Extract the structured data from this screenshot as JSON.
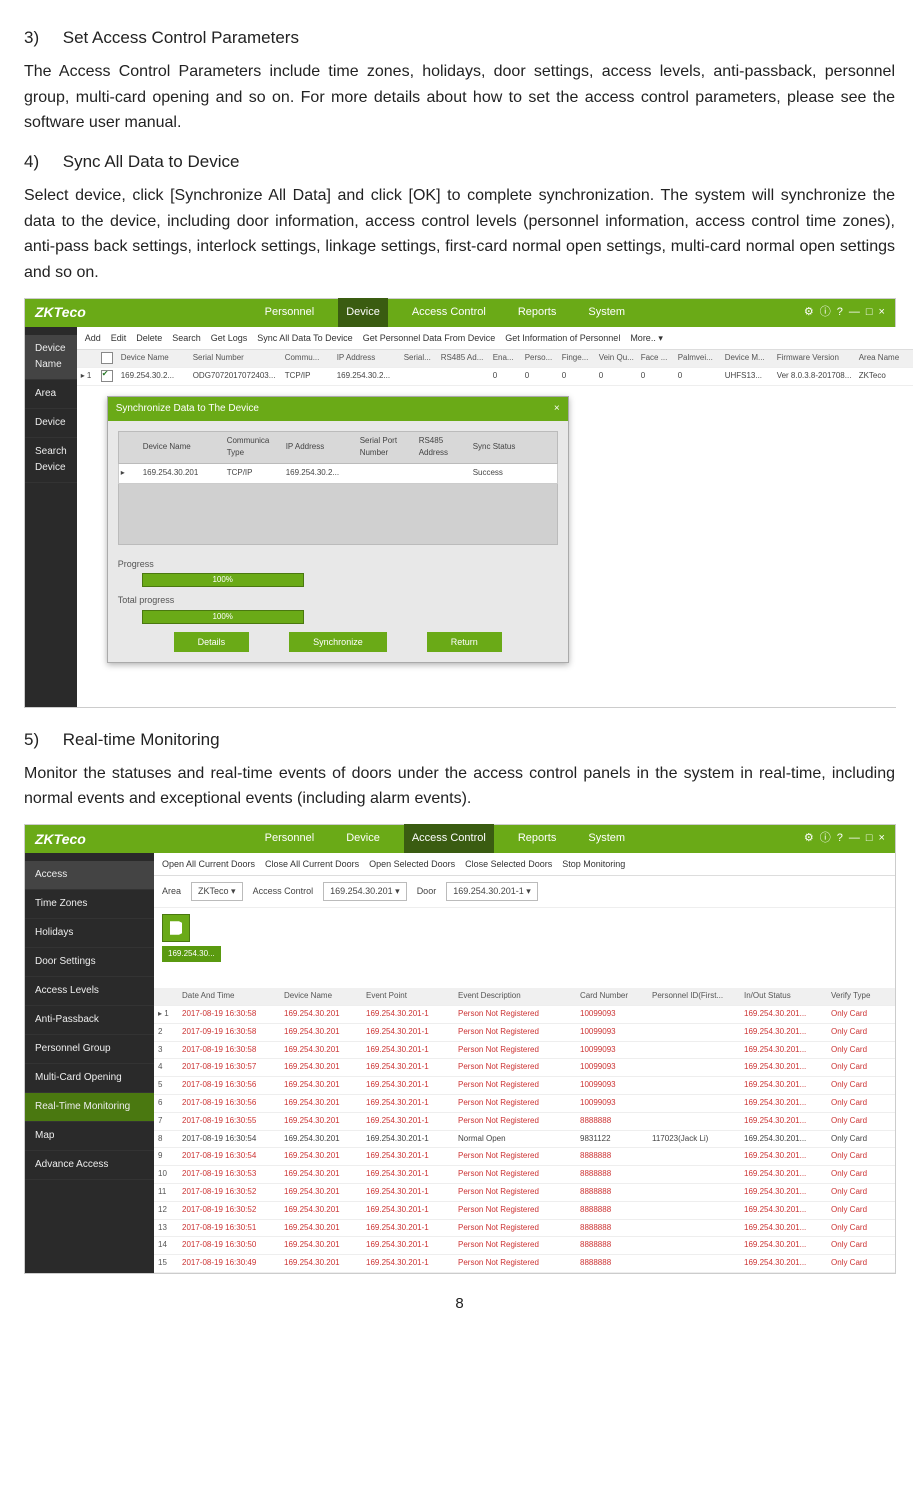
{
  "s3": {
    "num": "3)",
    "title": "Set Access Control Parameters",
    "para": "The Access Control Parameters include time zones, holidays, door settings, access levels, anti-passback, personnel group, multi-card opening and so on. For more details about how to set the access control parameters, please see the software user manual."
  },
  "s4": {
    "num": "4)",
    "title": "Sync All Data to Device",
    "para": "Select device, click [Synchronize All Data] and click [OK] to complete synchronization. The system will synchronize the data to the device, including door information, access control levels (personnel information, access control time zones), anti-pass back settings, interlock settings, linkage settings, first-card normal open settings, multi-card normal open settings and so on."
  },
  "s5": {
    "num": "5)",
    "title": "Real-time Monitoring",
    "para": "Monitor the statuses and real-time events of doors under the access control panels in the system in real-time, including normal events and exceptional events (including alarm events)."
  },
  "page_number": "8",
  "app_logo": "ZKTeco",
  "app1": {
    "menu": [
      "Personnel",
      "Device",
      "Access Control",
      "Reports",
      "System"
    ],
    "active_menu_index": 1,
    "win_icons": [
      "⚙",
      "ⓘ",
      "?",
      "—",
      "□",
      "×"
    ],
    "sidebar": {
      "items": [
        "Device Name",
        "Area",
        "Device",
        "Search Device"
      ],
      "selected_index": 0
    },
    "toolbar": [
      "Add",
      "Edit",
      "Delete",
      "Search",
      "Get Logs",
      "Sync All Data To Device",
      "Get Personnel Data From Device",
      "Get Information of Personnel",
      "More..  ▾"
    ],
    "cols": [
      "",
      "",
      "Device Name",
      "Serial Number",
      "Commu...",
      "IP Address",
      "Serial...",
      "RS485 Ad...",
      "Ena...",
      "Perso...",
      "Finge...",
      "Vein Qu...",
      "Face ...",
      "Palmvei...",
      "Device M...",
      "Firmware Version",
      "Area Name"
    ],
    "row1": {
      "idx": "▸ 1",
      "dev": "169.254.30.2...",
      "sn": "ODG7072017072403...",
      "comm": "TCP/IP",
      "ip": "169.254.30.2...",
      "ena": "0",
      "perso": "0",
      "finge": "0",
      "vein": "0",
      "face": "0",
      "palm": "0",
      "devm": "UHFS13...",
      "fw": "Ver 8.0.3.8-201708...",
      "area": "ZKTeco"
    },
    "modal": {
      "title": "Synchronize Data to The Device",
      "close": "×",
      "cols": [
        "",
        "Device Name",
        "Communica Type",
        "IP Address",
        "Serial Port Number",
        "RS485 Address",
        "Sync Status"
      ],
      "row": {
        "mark": "▸",
        "dev": "169.254.30.201",
        "type": "TCP/IP",
        "ip": "169.254.30.2...",
        "status": "Success"
      },
      "progress_label": "Progress",
      "total_label": "Total progress",
      "percent": "100%",
      "btns": [
        "Details",
        "Synchronize",
        "Return"
      ]
    }
  },
  "app2": {
    "menu": [
      "Personnel",
      "Device",
      "Access Control",
      "Reports",
      "System"
    ],
    "active_menu_index": 2,
    "win_icons": [
      "⚙",
      "ⓘ",
      "?",
      "—",
      "□",
      "×"
    ],
    "sidebar": {
      "items": [
        "Access",
        "Time Zones",
        "Holidays",
        "Door Settings",
        "Access Levels",
        "Anti-Passback",
        "Personnel Group",
        "Multi-Card Opening",
        "Real-Time Monitoring",
        "Map",
        "Advance Access"
      ],
      "selected_index": 0,
      "highlight_index": 8
    },
    "toolbar": [
      "Open All Current Doors",
      "Close All Current Doors",
      "Open Selected Doors",
      "Close Selected Doors",
      "Stop Monitoring"
    ],
    "filters": {
      "area_label": "Area",
      "area_value": "ZKTeco",
      "ac_label": "Access Control",
      "ac_value": "169.254.30.201",
      "door_label": "Door",
      "door_value": "169.254.30.201-1"
    },
    "ip_chip": "169.254.30...",
    "cols": [
      "",
      "Date And Time",
      "Device Name",
      "Event Point",
      "Event Description",
      "Card Number",
      "Personnel ID(First...",
      "In/Out Status",
      "Verify Type"
    ],
    "rows": [
      {
        "n": "▸ 1",
        "dt": "2017-08-19 16:30:58",
        "dev": "169.254.30.201",
        "ep": "169.254.30.201-1",
        "desc": "Person Not Registered",
        "card": "10099093",
        "pid": "",
        "io": "169.254.30.201...",
        "vt": "Only Card",
        "red": true
      },
      {
        "n": "2",
        "dt": "2017-09-19 16:30:58",
        "dev": "169.254.30.201",
        "ep": "169.254.30.201-1",
        "desc": "Person Not Registered",
        "card": "10099093",
        "pid": "",
        "io": "169.254.30.201...",
        "vt": "Only Card",
        "red": true
      },
      {
        "n": "3",
        "dt": "2017-08-19 16:30:58",
        "dev": "169.254.30.201",
        "ep": "169.254.30.201-1",
        "desc": "Person Not Registered",
        "card": "10099093",
        "pid": "",
        "io": "169.254.30.201...",
        "vt": "Only Card",
        "red": true
      },
      {
        "n": "4",
        "dt": "2017-08-19 16:30:57",
        "dev": "169.254.30.201",
        "ep": "169.254.30.201-1",
        "desc": "Person Not Registered",
        "card": "10099093",
        "pid": "",
        "io": "169.254.30.201...",
        "vt": "Only Card",
        "red": true
      },
      {
        "n": "5",
        "dt": "2017-08-19 16:30:56",
        "dev": "169.254.30.201",
        "ep": "169.254.30.201-1",
        "desc": "Person Not Registered",
        "card": "10099093",
        "pid": "",
        "io": "169.254.30.201...",
        "vt": "Only Card",
        "red": true
      },
      {
        "n": "6",
        "dt": "2017-08-19 16:30:56",
        "dev": "169.254.30.201",
        "ep": "169.254.30.201-1",
        "desc": "Person Not Registered",
        "card": "10099093",
        "pid": "",
        "io": "169.254.30.201...",
        "vt": "Only Card",
        "red": true
      },
      {
        "n": "7",
        "dt": "2017-08-19 16:30:55",
        "dev": "169.254.30.201",
        "ep": "169.254.30.201-1",
        "desc": "Person Not Registered",
        "card": "8888888",
        "pid": "",
        "io": "169.254.30.201...",
        "vt": "Only Card",
        "red": true
      },
      {
        "n": "8",
        "dt": "2017-08-19 16:30:54",
        "dev": "169.254.30.201",
        "ep": "169.254.30.201-1",
        "desc": "Normal Open",
        "card": "9831122",
        "pid": "117023(Jack Li)",
        "io": "169.254.30.201...",
        "vt": "Only Card",
        "red": false
      },
      {
        "n": "9",
        "dt": "2017-08-19 16:30:54",
        "dev": "169.254.30.201",
        "ep": "169.254.30.201-1",
        "desc": "Person Not Registered",
        "card": "8888888",
        "pid": "",
        "io": "169.254.30.201...",
        "vt": "Only Card",
        "red": true
      },
      {
        "n": "10",
        "dt": "2017-08-19 16:30:53",
        "dev": "169.254.30.201",
        "ep": "169.254.30.201-1",
        "desc": "Person Not Registered",
        "card": "8888888",
        "pid": "",
        "io": "169.254.30.201...",
        "vt": "Only Card",
        "red": true
      },
      {
        "n": "11",
        "dt": "2017-08-19 16:30:52",
        "dev": "169.254.30.201",
        "ep": "169.254.30.201-1",
        "desc": "Person Not Registered",
        "card": "8888888",
        "pid": "",
        "io": "169.254.30.201...",
        "vt": "Only Card",
        "red": true
      },
      {
        "n": "12",
        "dt": "2017-08-19 16:30:52",
        "dev": "169.254.30.201",
        "ep": "169.254.30.201-1",
        "desc": "Person Not Registered",
        "card": "8888888",
        "pid": "",
        "io": "169.254.30.201...",
        "vt": "Only Card",
        "red": true
      },
      {
        "n": "13",
        "dt": "2017-08-19 16:30:51",
        "dev": "169.254.30.201",
        "ep": "169.254.30.201-1",
        "desc": "Person Not Registered",
        "card": "8888888",
        "pid": "",
        "io": "169.254.30.201...",
        "vt": "Only Card",
        "red": true
      },
      {
        "n": "14",
        "dt": "2017-08-19 16:30:50",
        "dev": "169.254.30.201",
        "ep": "169.254.30.201-1",
        "desc": "Person Not Registered",
        "card": "8888888",
        "pid": "",
        "io": "169.254.30.201...",
        "vt": "Only Card",
        "red": true
      },
      {
        "n": "15",
        "dt": "2017-08-19 16:30:49",
        "dev": "169.254.30.201",
        "ep": "169.254.30.201-1",
        "desc": "Person Not Registered",
        "card": "8888888",
        "pid": "",
        "io": "169.254.30.201...",
        "vt": "Only Card",
        "red": true
      }
    ]
  }
}
